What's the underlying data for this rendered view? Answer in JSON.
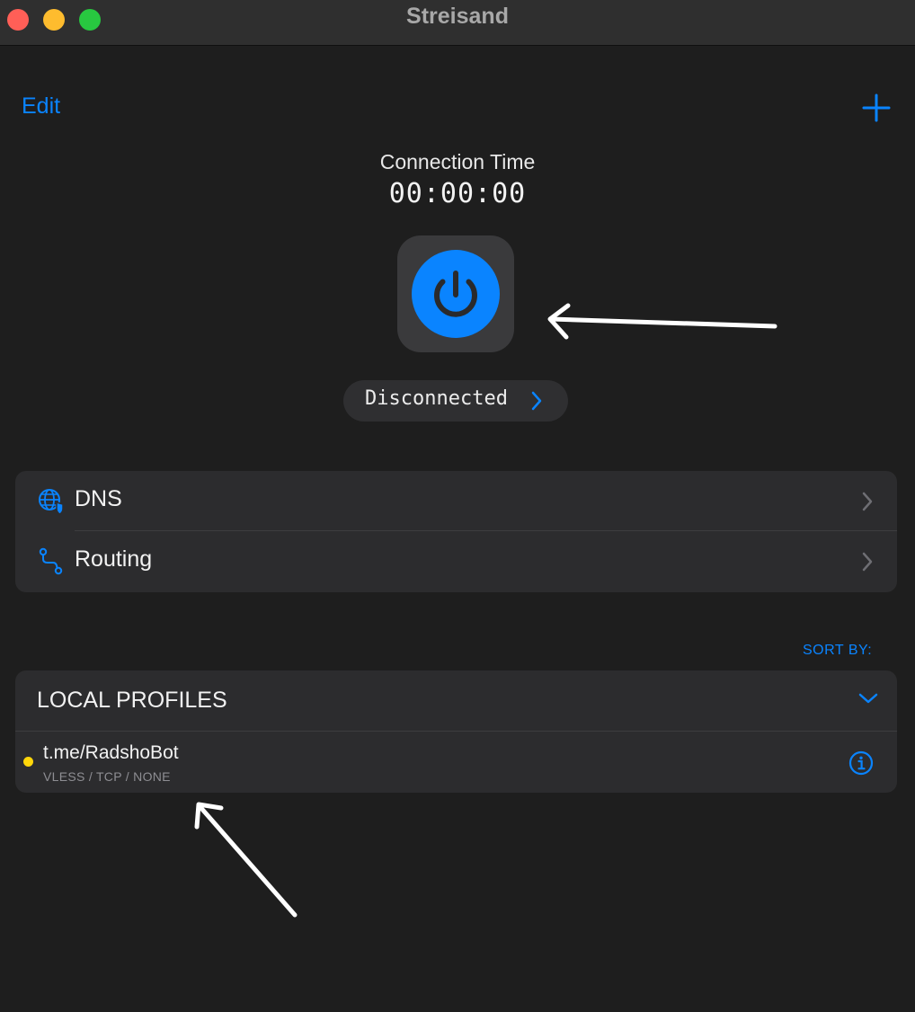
{
  "window": {
    "title": "Streisand"
  },
  "toolbar": {
    "edit_label": "Edit",
    "add_icon": "plus-icon"
  },
  "connection": {
    "time_label": "Connection Time",
    "time_value": "00:00:00",
    "status_label": "Disconnected",
    "power_icon": "power-icon"
  },
  "settings": {
    "items": [
      {
        "label": "DNS",
        "icon": "globe-shield-icon"
      },
      {
        "label": "Routing",
        "icon": "route-icon"
      }
    ]
  },
  "profiles": {
    "sort_label": "SORT BY:",
    "section_title": "LOCAL PROFILES",
    "items": [
      {
        "name": "t.me/RadshoBot",
        "meta": "VLESS / TCP / NONE",
        "status_color": "#ffd60a"
      }
    ]
  },
  "colors": {
    "accent": "#0a84ff",
    "background": "#1e1e1e",
    "card": "#2c2c2e",
    "status_dot": "#ffd60a"
  }
}
